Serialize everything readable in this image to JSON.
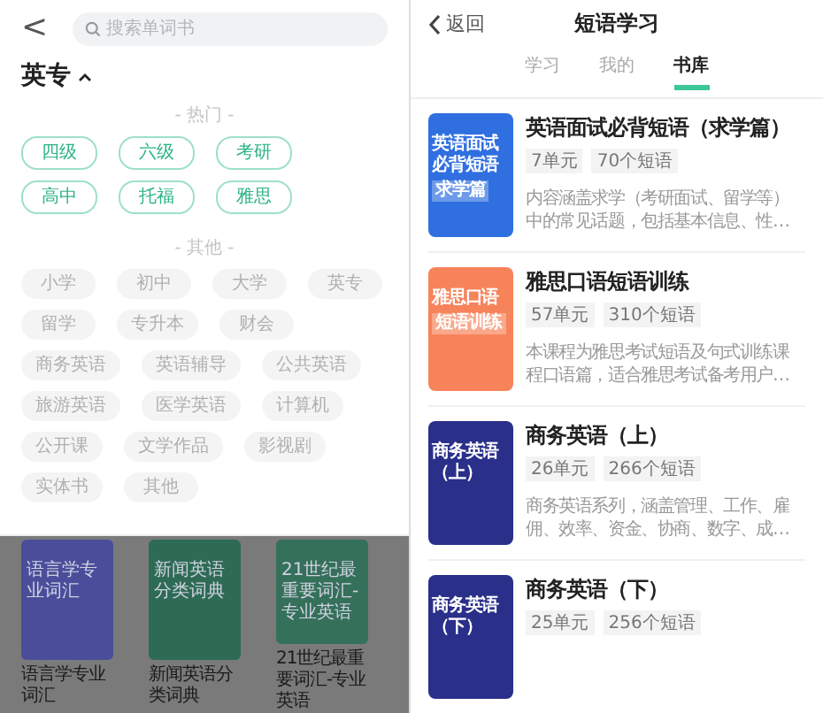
{
  "wordbook_panel": {
    "back_button": "<",
    "search": {
      "placeholder": "搜索单词书"
    },
    "category_title": "英专",
    "expanded": true,
    "hot_section": {
      "label": "- 热门 -",
      "chips": [
        "四级",
        "六级",
        "考研",
        "高中",
        "托福",
        "雅思"
      ]
    },
    "other_section": {
      "label": "- 其他 -",
      "chips": [
        "小学",
        "初中",
        "大学",
        "英专",
        "留学",
        "专升本",
        "财会",
        "商务英语",
        "英语辅导",
        "公共英语",
        "旅游英语",
        "医学英语",
        "计算机",
        "公开课",
        "文学作品",
        "影视剧",
        "实体书",
        "其他"
      ]
    },
    "books": [
      {
        "cover_text": "语言学专业词汇",
        "color": "#4a4e9a",
        "title": "语言学专业词汇"
      },
      {
        "cover_text": "新闻英语分类词典",
        "color": "#2e6b55",
        "title": "新闻英语分类词典"
      },
      {
        "cover_text": "21世纪最重要词汇-专业英语",
        "color": "#35705a",
        "title": "21世纪最重要词汇-专业英语"
      }
    ]
  },
  "phrase_panel": {
    "back_button": "返回",
    "title": "短语学习",
    "tabs": [
      {
        "label": "学习",
        "selected": false
      },
      {
        "label": "我的",
        "selected": false
      },
      {
        "label": "书库",
        "selected": true
      }
    ],
    "books": [
      {
        "cover_text": "英语面试必背短语",
        "cover_tag": "求学篇",
        "color": "#2f6fe0",
        "title": "英语面试必背短语（求学篇）",
        "units": "7单元",
        "phrases": "70个短语",
        "description": "内容涵盖求学（考研面试、留学等）中的常见话题，包括基本信息、性…"
      },
      {
        "cover_text": "雅思口语",
        "cover_tag": "短语训练",
        "color": "#f7835a",
        "title": "雅思口语短语训练",
        "units": "57单元",
        "phrases": "310个短语",
        "description": "本课程为雅思考试短语及句式训练课程口语篇，适合雅思考试备考用户…"
      },
      {
        "cover_text": "商务英语（上）",
        "color": "#2a2f8a",
        "title": "商务英语（上）",
        "units": "26单元",
        "phrases": "266个短语",
        "description": "商务英语系列，涵盖管理、工作、雇佣、效率、资金、协商、数字、成…"
      },
      {
        "cover_text": "商务英语（下）",
        "color": "#2a2f8a",
        "title": "商务英语（下）",
        "units": "25单元",
        "phrases": "256个短语"
      }
    ]
  }
}
